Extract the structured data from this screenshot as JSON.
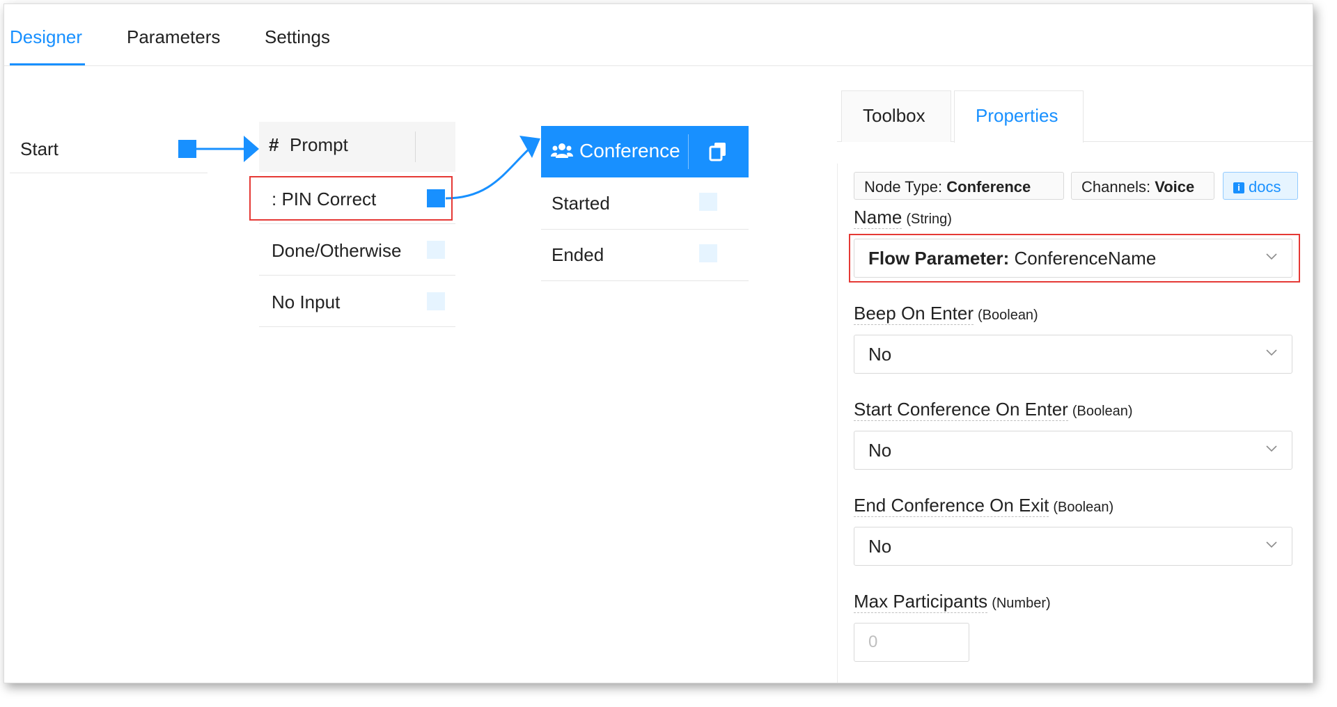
{
  "top_tabs": {
    "designer": "Designer",
    "parameters": "Parameters",
    "settings": "Settings"
  },
  "canvas": {
    "start_label": "Start",
    "prompt": {
      "title_hash": "#",
      "title": "Prompt",
      "outputs": [
        ": PIN Correct",
        "Done/Otherwise",
        "No Input"
      ]
    },
    "conference": {
      "title": "Conference",
      "outputs": [
        "Started",
        "Ended"
      ]
    },
    "accent_color": "#1890ff",
    "highlight_color": "#e53935"
  },
  "panel": {
    "tabs": {
      "toolbox": "Toolbox",
      "properties": "Properties"
    },
    "chips": {
      "node_type_label": "Node Type:",
      "node_type_value": "Conference",
      "channels_label": "Channels:",
      "channels_value": "Voice",
      "docs_label": "docs"
    },
    "fields": {
      "name": {
        "label": "Name",
        "type": "(String)",
        "value_prefix": "Flow Parameter:",
        "value": "ConferenceName"
      },
      "beep_on_enter": {
        "label": "Beep On Enter",
        "type": "(Boolean)",
        "value": "No"
      },
      "start_conference_on_enter": {
        "label": "Start Conference On Enter",
        "type": "(Boolean)",
        "value": "No"
      },
      "end_conference_on_exit": {
        "label": "End Conference On Exit",
        "type": "(Boolean)",
        "value": "No"
      },
      "max_participants": {
        "label": "Max Participants",
        "type": "(Number)",
        "placeholder": "0"
      }
    }
  }
}
